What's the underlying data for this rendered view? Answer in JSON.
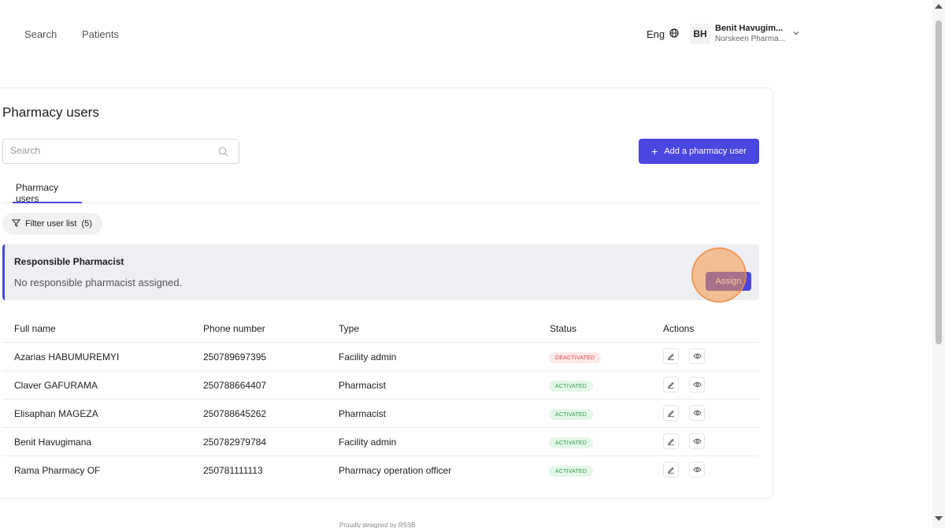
{
  "nav": {
    "links": [
      "Search",
      "Patients"
    ],
    "language": "Eng",
    "user": {
      "initials": "BH",
      "name": "Benit Havugim...",
      "org": "Norskeen Pharma..."
    }
  },
  "page": {
    "title": "Pharmacy users",
    "search_placeholder": "Search",
    "search_value": "",
    "add_button_label": "Add a pharmacy user",
    "tabs": [
      {
        "label": "Pharmacy users",
        "active": true
      }
    ],
    "filter_label": "Filter user list  (5)"
  },
  "responsible": {
    "title": "Responsible Pharmacist",
    "message": "No responsible pharmacist assigned.",
    "assign_label": "Assign"
  },
  "table": {
    "headers": [
      "Full name",
      "Phone number",
      "Type",
      "Status",
      "Actions"
    ],
    "rows": [
      {
        "name": "Azarias HABUMUREMYI",
        "phone": "250789697395",
        "type": "Facility admin",
        "status": "DEACTIVATED"
      },
      {
        "name": "Claver GAFURAMA",
        "phone": "250788664407",
        "type": "Pharmacist",
        "status": "ACTIVATED"
      },
      {
        "name": "Elisaphan MAGEZA",
        "phone": "250788645262",
        "type": "Pharmacist",
        "status": "ACTIVATED"
      },
      {
        "name": "Benit Havugimana",
        "phone": "250782979784",
        "type": "Facility admin",
        "status": "ACTIVATED"
      },
      {
        "name": "Rama Pharmacy OF",
        "phone": "250781111113",
        "type": "Pharmacy operation officer",
        "status": "ACTIVATED"
      }
    ]
  },
  "footer": {
    "text": "Proudly designed by RSSB"
  },
  "colors": {
    "primary": "#4a46e0",
    "deactivated_bg": "#fde9e9",
    "deactivated_text": "#d9434b",
    "activated_bg": "#e4f7e8",
    "activated_text": "#2e9d4b",
    "highlight": "#f59646"
  },
  "icons": {
    "language": "globe-icon",
    "user_menu": "chevron-down-icon",
    "search": "search-icon",
    "add": "plus-icon",
    "filter": "filter-icon",
    "edit": "edit-icon",
    "view": "eye-icon"
  }
}
